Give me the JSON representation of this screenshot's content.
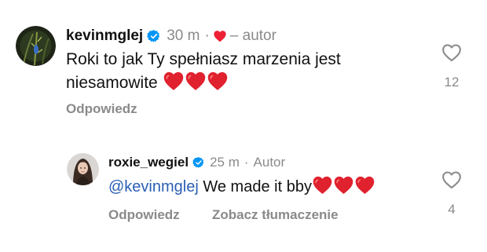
{
  "comments": [
    {
      "username": "kevinmglej",
      "time": "30 m",
      "separator": "·",
      "author_label": "– autor",
      "text_line1": "Roki to jak Ty spełniasz marzenia jest",
      "text_line2": "niesamowite",
      "emojis": [
        "red-heart",
        "red-heart",
        "red-heart"
      ],
      "reply_label": "Odpowiedz",
      "like_count": "12"
    },
    {
      "username": "roxie_wegiel",
      "time": "25 m",
      "separator": "·",
      "author_label": "Autor",
      "mention": "@kevinmglej",
      "text": "We made it bby",
      "emojis": [
        "red-heart",
        "red-heart",
        "red-heart"
      ],
      "reply_label": "Odpowiedz",
      "translate_label": "Zobacz tłumaczenie",
      "like_count": "4"
    }
  ],
  "icons": {
    "verified": "verified-badge-icon",
    "like": "heart-outline-icon",
    "author_like": "red-heart-icon"
  },
  "colors": {
    "verified_blue": "#0095f6",
    "heart_red": "#ed2135",
    "muted_text": "#8a8a8a",
    "mention_blue": "#2b5fb4"
  }
}
